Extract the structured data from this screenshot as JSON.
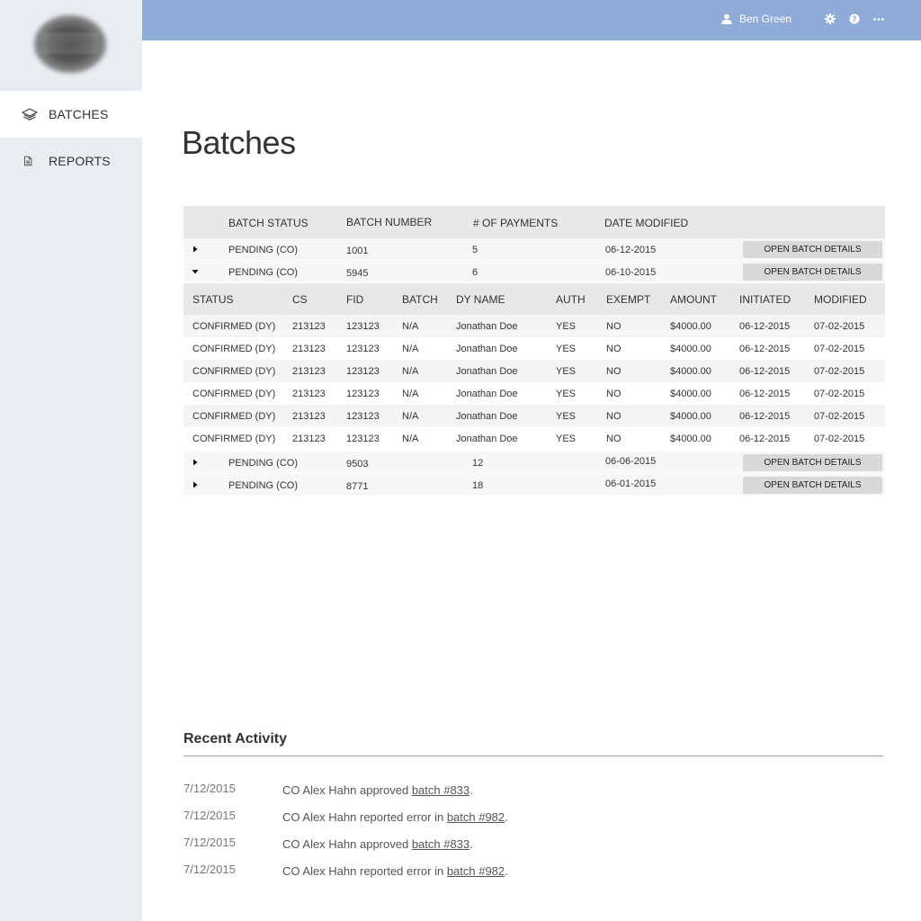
{
  "sidebar": {
    "items": [
      {
        "label": "BATCHES",
        "icon": "layers-icon",
        "active": true
      },
      {
        "label": "REPORTS",
        "icon": "document-icon",
        "active": false
      }
    ]
  },
  "topbar": {
    "user_name": "Ben Green",
    "icons": [
      "user-icon",
      "gear-icon",
      "help-icon",
      "more-icon"
    ],
    "background": "#8fabd8"
  },
  "page": {
    "title": "Batches"
  },
  "batches": {
    "headers": [
      "BATCH STATUS",
      "BATCH NUMBER",
      "# OF PAYMENTS",
      "DATE MODIFIED"
    ],
    "button_label": "OPEN BATCH DETAILS",
    "rows": [
      {
        "status": "PENDING (CO)",
        "number": "1001",
        "payments": "5",
        "date": "06-12-2015",
        "expanded": false
      },
      {
        "status": "PENDING (CO)",
        "number": "5945",
        "payments": "6",
        "date": "06-10-2015",
        "expanded": true
      },
      {
        "status": "PENDING (CO)",
        "number": "9503",
        "payments": "12",
        "date": "06-06-2015",
        "expanded": false
      },
      {
        "status": "PENDING (CO)",
        "number": "8771",
        "payments": "18",
        "date": "06-01-2015",
        "expanded": false
      }
    ]
  },
  "payments": {
    "headers": [
      "STATUS",
      "CS",
      "FID",
      "BATCH",
      "DY NAME",
      "AUTH",
      "EXEMPT",
      "AMOUNT",
      "INITIATED",
      "MODIFIED"
    ],
    "rows": [
      [
        "CONFIRMED (DY)",
        "213123",
        "123123",
        "N/A",
        "Jonathan Doe",
        "YES",
        "NO",
        "$4000.00",
        "06-12-2015",
        "07-02-2015"
      ],
      [
        "CONFIRMED (DY)",
        "213123",
        "123123",
        "N/A",
        "Jonathan Doe",
        "YES",
        "NO",
        "$4000.00",
        "06-12-2015",
        "07-02-2015"
      ],
      [
        "CONFIRMED (DY)",
        "213123",
        "123123",
        "N/A",
        "Jonathan Doe",
        "YES",
        "NO",
        "$4000.00",
        "06-12-2015",
        "07-02-2015"
      ],
      [
        "CONFIRMED (DY)",
        "213123",
        "123123",
        "N/A",
        "Jonathan Doe",
        "YES",
        "NO",
        "$4000.00",
        "06-12-2015",
        "07-02-2015"
      ],
      [
        "CONFIRMED (DY)",
        "213123",
        "123123",
        "N/A",
        "Jonathan Doe",
        "YES",
        "NO",
        "$4000.00",
        "06-12-2015",
        "07-02-2015"
      ],
      [
        "CONFIRMED (DY)",
        "213123",
        "123123",
        "N/A",
        "Jonathan Doe",
        "YES",
        "NO",
        "$4000.00",
        "06-12-2015",
        "07-02-2015"
      ]
    ]
  },
  "recent_activity": {
    "title": "Recent Activity",
    "items": [
      {
        "date": "7/12/2015",
        "prefix": "CO Alex Hahn approved ",
        "link": "batch #833",
        "suffix": "."
      },
      {
        "date": "7/12/2015",
        "prefix": "CO Alex Hahn reported error in ",
        "link": "batch #982",
        "suffix": "."
      },
      {
        "date": "7/12/2015",
        "prefix": "CO Alex Hahn approved ",
        "link": "batch #833",
        "suffix": "."
      },
      {
        "date": "7/12/2015",
        "prefix": "CO Alex Hahn reported error in ",
        "link": "batch #982",
        "suffix": "."
      }
    ]
  }
}
